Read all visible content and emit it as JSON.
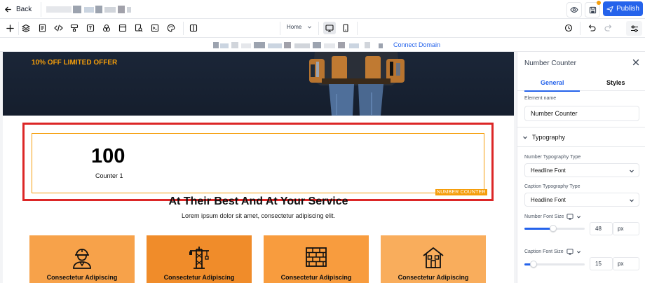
{
  "topbar": {
    "back_label": "Back",
    "publish_label": "Publish"
  },
  "toolbar": {
    "page_selected": "Home"
  },
  "domainbar": {
    "connect_label": "Connect Domain"
  },
  "canvas": {
    "hero_offer": "10% OFF LIMITED OFFER",
    "counter": {
      "number": "100",
      "caption": "Counter 1",
      "element_tag": "NUMBER COUNTER"
    },
    "section_title": "At Their Best And At Your Service",
    "section_subtitle": "Lorem ipsum dolor sit amet, consectetur adipiscing elit.",
    "cards": [
      {
        "label": "Consectetur Adipiscing",
        "icon": "worker-icon",
        "color": "#f7a24a"
      },
      {
        "label": "Consectetur Adipiscing",
        "icon": "crane-icon",
        "color": "#f08c2a"
      },
      {
        "label": "Consectetur Adipiscing",
        "icon": "brick-wall-icon",
        "color": "#f89c3e"
      },
      {
        "label": "Consectetur Adipiscing",
        "icon": "house-icon",
        "color": "#f9ad5c"
      }
    ]
  },
  "panel": {
    "title": "Number Counter",
    "tabs": [
      "General",
      "Styles"
    ],
    "active_tab": "General",
    "element_name_label": "Element name",
    "element_name_value": "Number Counter",
    "typography_heading": "Typography",
    "number_type_label": "Number Typography Type",
    "number_type_value": "Headline Font",
    "caption_type_label": "Caption Typography Type",
    "caption_type_value": "Headline Font",
    "number_size_label": "Number Font Size",
    "number_size_value": "48",
    "number_size_unit": "px",
    "number_size_fraction": 0.48,
    "caption_size_label": "Caption Font Size",
    "caption_size_value": "15",
    "caption_size_unit": "px",
    "caption_size_fraction": 0.15
  },
  "colors": {
    "accent": "#2563eb",
    "selection": "#dc2626",
    "highlight": "#f59e0b"
  }
}
